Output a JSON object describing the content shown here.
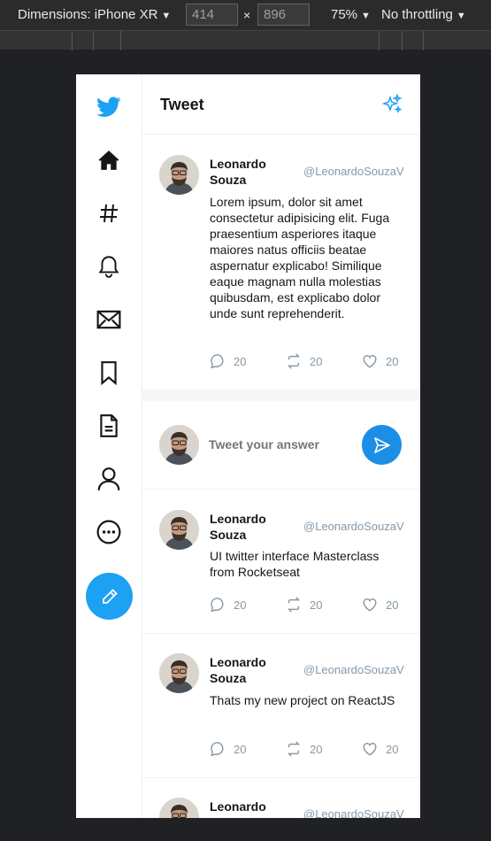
{
  "devtools": {
    "dimensions_label": "Dimensions: iPhone XR",
    "width_value": "414",
    "height_value": "896",
    "times": "×",
    "zoom": "75%",
    "throttling": "No throttling"
  },
  "sidebar": {
    "items": [
      "twitter-logo",
      "home",
      "explore-hashtag",
      "notifications",
      "messages",
      "bookmarks",
      "lists",
      "profile",
      "more"
    ]
  },
  "header": {
    "title": "Tweet"
  },
  "tweets": [
    {
      "name": "Leonardo Souza",
      "handle": "@LeonardoSouzaV",
      "text": "Lorem ipsum, dolor sit amet consectetur adipisicing elit. Fuga praesentium asperiores itaque maiores natus officiis beatae aspernatur explicabo! Similique eaque magnam nulla molestias quibusdam, est explicabo dolor unde sunt reprehenderit.",
      "comments": "20",
      "retweets": "20",
      "likes": "20"
    },
    {
      "name": "Leonardo Souza",
      "handle": "@LeonardoSouzaV",
      "text": "UI twitter interface Masterclass from Rocketseat",
      "comments": "20",
      "retweets": "20",
      "likes": "20"
    },
    {
      "name": "Leonardo Souza",
      "handle": "@LeonardoSouzaV",
      "text": "Thats my new project on ReactJS",
      "comments": "20",
      "retweets": "20",
      "likes": "20"
    },
    {
      "name": "Leonardo Souza",
      "handle": "@LeonardoSouzaV"
    }
  ],
  "reply": {
    "placeholder": "Tweet your answer"
  },
  "colors": {
    "accent": "#1da1f2",
    "muted": "#8899a6",
    "text": "#14171a"
  }
}
